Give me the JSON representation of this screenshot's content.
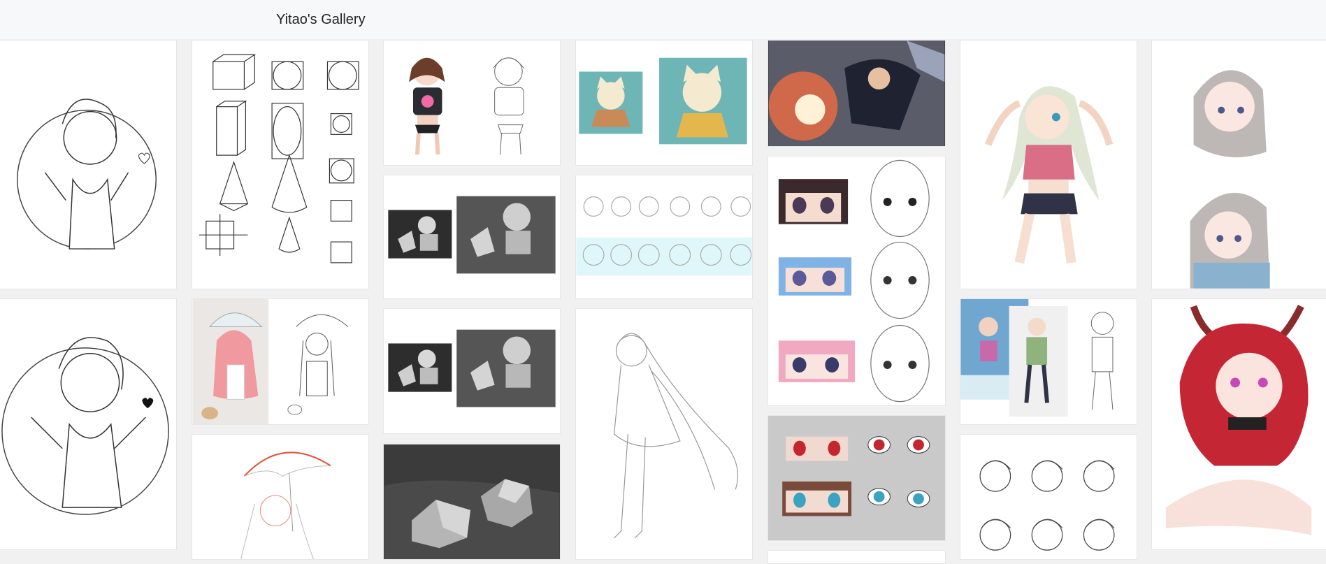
{
  "header": {
    "title": "Yitao's Gallery"
  },
  "gallery": {
    "columns": 7,
    "items": [
      {
        "id": "lineart-girl-peace-sign-1"
      },
      {
        "id": "lineart-girl-peace-sign-2"
      },
      {
        "id": "perspective-boxes-sketch"
      },
      {
        "id": "umbrella-girl-color-and-lineart"
      },
      {
        "id": "umbrella-girl-red-sketch"
      },
      {
        "id": "girl-color-and-lineart"
      },
      {
        "id": "geometry-still-life-1"
      },
      {
        "id": "geometry-still-life-2"
      },
      {
        "id": "polyhedra-still-life"
      },
      {
        "id": "chibi-cat-character"
      },
      {
        "id": "head-angle-studies"
      },
      {
        "id": "longhair-girl-lineart"
      },
      {
        "id": "action-scene-painting"
      },
      {
        "id": "eye-studies-with-faces"
      },
      {
        "id": "eye-color-studies"
      },
      {
        "id": "elizabeth-character-pose"
      },
      {
        "id": "character-references-and-sketch"
      },
      {
        "id": "male-head-sketches"
      },
      {
        "id": "silver-hair-girl-portraits"
      },
      {
        "id": "red-hair-horned-girl"
      }
    ]
  }
}
